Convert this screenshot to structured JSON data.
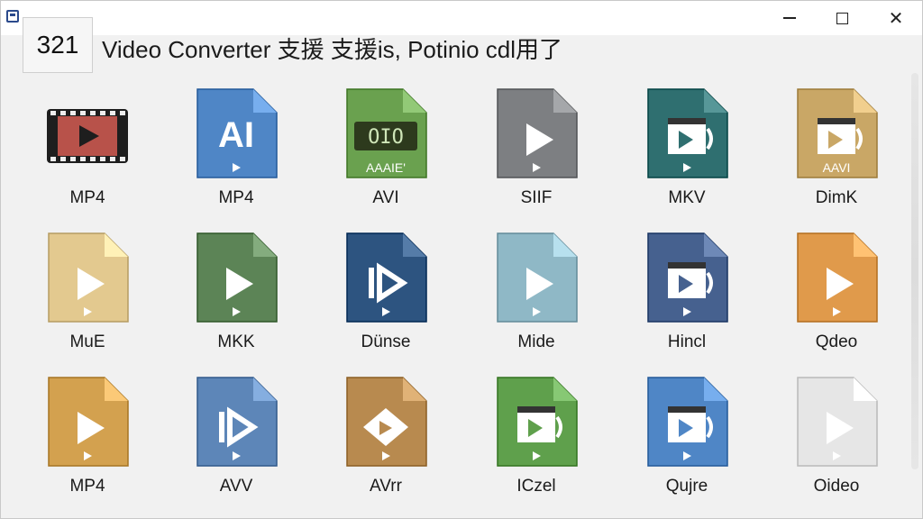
{
  "window": {
    "title_number": "321",
    "title_text": "Video Converter  支援 支援is,  Potinio  cdl用了"
  },
  "colors": {
    "titlebar_bg": "#ffffff",
    "body_bg": "#f1f1f1"
  },
  "files": [
    {
      "label": "MP4",
      "icon": "film-strip-icon",
      "color": "#b8524a",
      "glyph": "play",
      "text": ""
    },
    {
      "label": "MP4",
      "icon": "ai-file-icon",
      "color": "#4f86c6",
      "glyph": "AI",
      "text": ""
    },
    {
      "label": "AVI",
      "icon": "avi-file-icon",
      "color": "#6aa14f",
      "glyph": "OIO",
      "text": "AAAIE'"
    },
    {
      "label": "SIIF",
      "icon": "video-file-icon",
      "color": "#7d7f82",
      "glyph": "play",
      "text": ""
    },
    {
      "label": "MKV",
      "icon": "video-file-icon",
      "color": "#2f6f70",
      "glyph": "clap",
      "text": ""
    },
    {
      "label": "DimK",
      "icon": "video-file-icon",
      "color": "#c9a766",
      "glyph": "clap",
      "text": "AAVI"
    },
    {
      "label": "MuE",
      "icon": "video-file-icon",
      "color": "#e3c98f",
      "glyph": "play",
      "text": ""
    },
    {
      "label": "MKK",
      "icon": "video-file-icon",
      "color": "#5c8456",
      "glyph": "play",
      "text": ""
    },
    {
      "label": "Dünse",
      "icon": "video-file-icon",
      "color": "#2d5480",
      "glyph": "bar-play",
      "text": ""
    },
    {
      "label": "Mide",
      "icon": "video-file-icon",
      "color": "#8fb8c6",
      "glyph": "play",
      "text": ""
    },
    {
      "label": "Hincl",
      "icon": "video-file-icon",
      "color": "#46618f",
      "glyph": "clap",
      "text": ""
    },
    {
      "label": "Qdeo",
      "icon": "video-file-icon",
      "color": "#e09a4b",
      "glyph": "play",
      "text": ""
    },
    {
      "label": "MP4",
      "icon": "video-file-icon",
      "color": "#d3a14f",
      "glyph": "play",
      "text": ""
    },
    {
      "label": "AVV",
      "icon": "video-file-icon",
      "color": "#5d86b8",
      "glyph": "bar-play",
      "text": ""
    },
    {
      "label": "AVrr",
      "icon": "video-file-icon",
      "color": "#b88a4f",
      "glyph": "diamond",
      "text": ""
    },
    {
      "label": "ICzel",
      "icon": "video-file-icon",
      "color": "#5fa04c",
      "glyph": "clap",
      "text": ""
    },
    {
      "label": "Qujre",
      "icon": "video-file-icon",
      "color": "#4f86c6",
      "glyph": "clap",
      "text": ""
    },
    {
      "label": "Oideo",
      "icon": "video-file-icon",
      "color": "#e6e6e6",
      "glyph": "play",
      "text": ""
    }
  ]
}
